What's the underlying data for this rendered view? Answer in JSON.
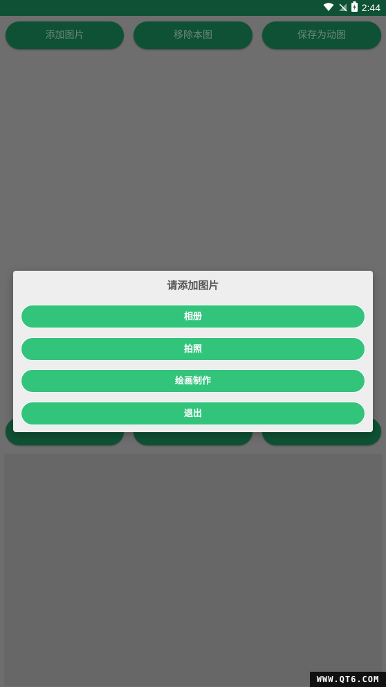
{
  "status_bar": {
    "time": "2:44",
    "icons": [
      "wifi-icon",
      "no-signal-icon",
      "battery-charging-icon"
    ]
  },
  "toolbar": {
    "add_image": "添加图片",
    "remove_image": "移除本图",
    "save_gif": "保存为动图"
  },
  "dialog": {
    "title": "请添加图片",
    "options": [
      "相册",
      "拍照",
      "绘画制作",
      "退出"
    ]
  },
  "watermark": "WWW.QT6.COM",
  "colors": {
    "status_bar_bg": "#0f5135",
    "button_bg": "#0f5135",
    "dialog_button": "#33c47c",
    "dialog_bg": "#eeeeee"
  }
}
